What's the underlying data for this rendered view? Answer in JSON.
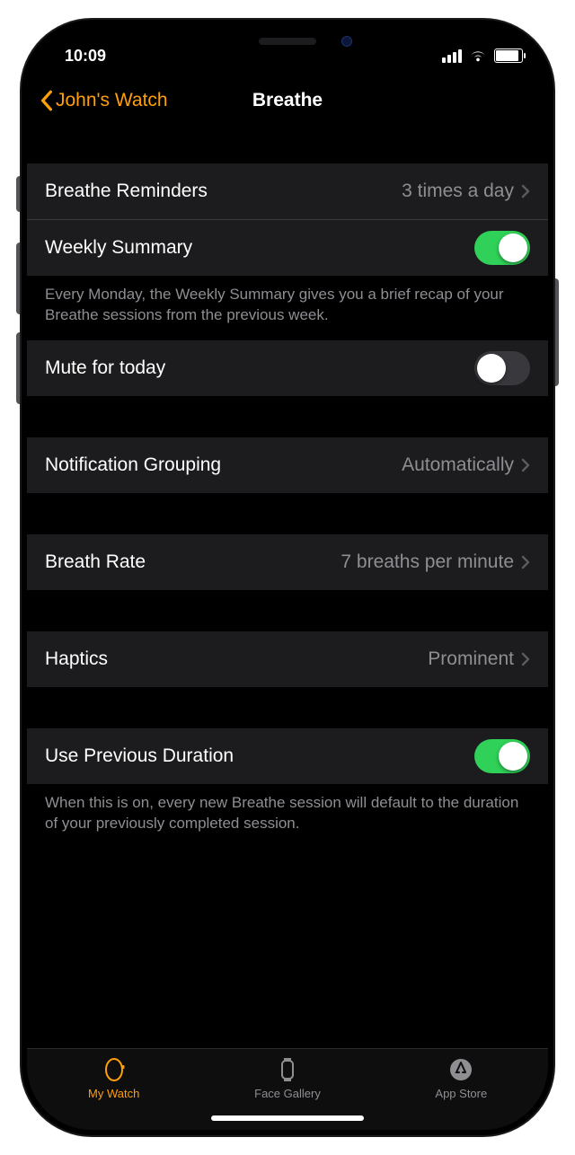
{
  "status": {
    "time": "10:09"
  },
  "nav": {
    "back": "John's Watch",
    "title": "Breathe"
  },
  "s1": {
    "reminders": {
      "label": "Breathe Reminders",
      "value": "3 times a day"
    },
    "weekly": {
      "label": "Weekly Summary",
      "on": true
    },
    "footer": "Every Monday, the Weekly Summary gives you a brief recap of your Breathe sessions from the previous week."
  },
  "s2": {
    "mute": {
      "label": "Mute for today",
      "on": false
    }
  },
  "s3": {
    "grouping": {
      "label": "Notification Grouping",
      "value": "Automatically"
    }
  },
  "s4": {
    "rate": {
      "label": "Breath Rate",
      "value": "7 breaths per minute"
    }
  },
  "s5": {
    "haptics": {
      "label": "Haptics",
      "value": "Prominent"
    }
  },
  "s6": {
    "prev": {
      "label": "Use Previous Duration",
      "on": true
    },
    "footer": "When this is on, every new Breathe session will default to the duration of your previously completed session."
  },
  "tabs": {
    "watch": "My Watch",
    "gallery": "Face Gallery",
    "store": "App Store"
  }
}
